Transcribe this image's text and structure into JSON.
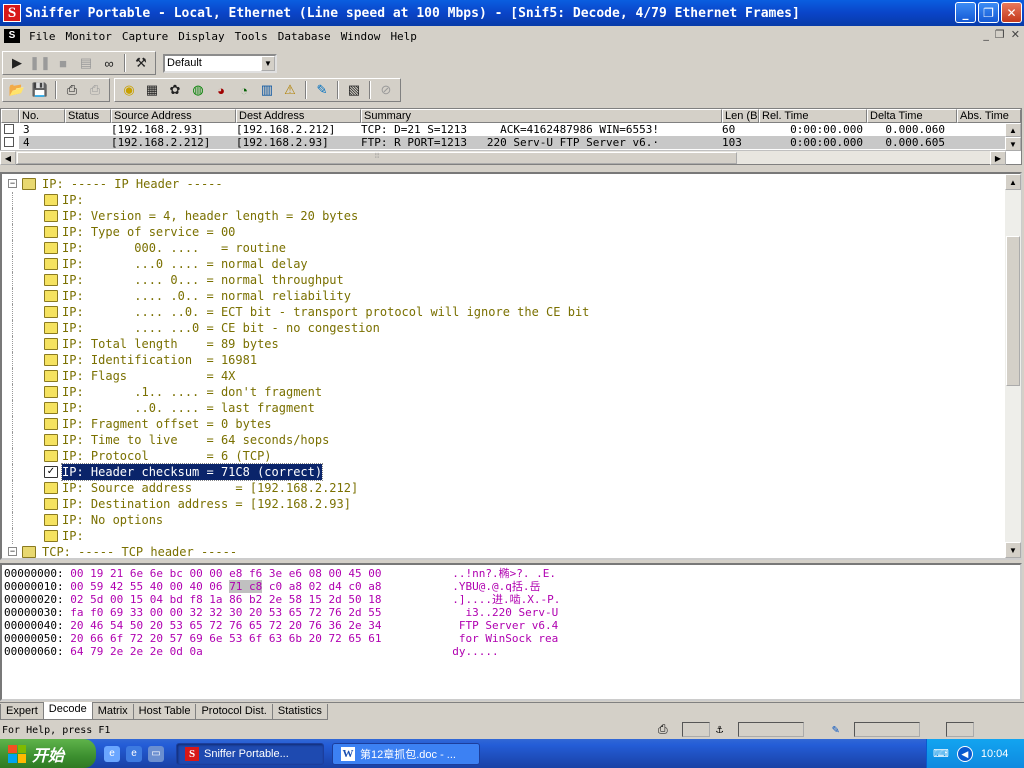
{
  "window": {
    "app_icon": "S",
    "title": "Sniffer Portable - Local, Ethernet (Line speed at 100 Mbps) - [Snif5: Decode, 4/79 Ethernet Frames]",
    "minimize": "_",
    "restore": "❐",
    "close": "✕"
  },
  "menubar": {
    "items": [
      "File",
      "Monitor",
      "Capture",
      "Display",
      "Tools",
      "Database",
      "Window",
      "Help"
    ],
    "mdi_minimize": "_",
    "mdi_restore": "❐",
    "mdi_close": "✕"
  },
  "toolbar": {
    "profile_select": "Default",
    "buttons_row1": [
      "play-icon",
      "pause-icon",
      "stop-icon",
      "stop-display-icon",
      "binoculars-icon",
      "capture-filter-icon"
    ],
    "buttons_row2": [
      "open-folder-icon",
      "save-icon",
      "print-icon",
      "print-preview-icon",
      "dashboard-icon",
      "host-table-icon",
      "matrix-icon",
      "application-response-icon",
      "history-icon",
      "protocol-dist-icon",
      "global-statistics-icon",
      "alarm-log-icon",
      "define-filter-icon",
      "select-filter-icon",
      "stop-capture-icon"
    ]
  },
  "summary": {
    "headers": [
      "No.",
      "Status",
      "Source Address",
      "Dest Address",
      "Summary",
      "Len (B",
      "Rel. Time",
      "Delta Time",
      "Abs. Time"
    ],
    "rows": [
      {
        "no": "3",
        "status": "",
        "src": "[192.168.2.93]",
        "dst": "[192.168.2.212]",
        "summary": "TCP: D=21 S=1213     ACK=4162487986 WIN=6553!",
        "len": "60",
        "rel": "0:00:00.000",
        "delta": "0.000.060",
        "abs": ""
      },
      {
        "no": "4",
        "status": "",
        "src": "[192.168.2.212]",
        "dst": "[192.168.2.93]",
        "summary": "FTP: R PORT=1213   220 Serv-U FTP Server v6.·",
        "len": "103",
        "rel": "0:00:00.000",
        "delta": "0.000.605",
        "abs": ""
      }
    ]
  },
  "decode": {
    "lines": [
      {
        "text": "IP: ----- IP Header -----",
        "level": 0,
        "kind": "root"
      },
      {
        "text": "IP:",
        "level": 1
      },
      {
        "text": "IP: Version = 4, header length = 20 bytes",
        "level": 1
      },
      {
        "text": "IP: Type of service = 00",
        "level": 1
      },
      {
        "text": "IP:       000. ....   = routine",
        "level": 1
      },
      {
        "text": "IP:       ...0 .... = normal delay",
        "level": 1
      },
      {
        "text": "IP:       .... 0... = normal throughput",
        "level": 1
      },
      {
        "text": "IP:       .... .0.. = normal reliability",
        "level": 1
      },
      {
        "text": "IP:       .... ..0. = ECT bit - transport protocol will ignore the CE bit",
        "level": 1
      },
      {
        "text": "IP:       .... ...0 = CE bit - no congestion",
        "level": 1
      },
      {
        "text": "IP: Total length    = 89 bytes",
        "level": 1
      },
      {
        "text": "IP: Identification  = 16981",
        "level": 1
      },
      {
        "text": "IP: Flags           = 4X",
        "level": 1
      },
      {
        "text": "IP:       .1.. .... = don't fragment",
        "level": 1
      },
      {
        "text": "IP:       ..0. .... = last fragment",
        "level": 1
      },
      {
        "text": "IP: Fragment offset = 0 bytes",
        "level": 1
      },
      {
        "text": "IP: Time to live    = 64 seconds/hops",
        "level": 1
      },
      {
        "text": "IP: Protocol        = 6 (TCP)",
        "level": 1
      },
      {
        "text": "IP: Header checksum = 71C8 (correct)",
        "level": 1,
        "selected": true
      },
      {
        "text": "IP: Source address      = [192.168.2.212]",
        "level": 1
      },
      {
        "text": "IP: Destination address = [192.168.2.93]",
        "level": 1
      },
      {
        "text": "IP: No options",
        "level": 1
      },
      {
        "text": "IP:",
        "level": 1
      },
      {
        "text": "TCP: ----- TCP header -----",
        "level": 0,
        "kind": "root"
      }
    ]
  },
  "hex": {
    "rows": [
      {
        "offset": "00000000:",
        "bytes": "00 19 21 6e 6e bc 00 00 e8 f6 3e e6 08 00 45 00",
        "ascii": "..!nn?.椭>?. .E."
      },
      {
        "offset": "00000010:",
        "bytes": "00 59 42 55 40 00 40 06 71 c8 c0 a8 02 d4 c0 a8",
        "ascii": ".YBU@.@.q括.岳",
        "hl_bytes": "71 c8"
      },
      {
        "offset": "00000020:",
        "bytes": "02 5d 00 15 04 bd f8 1a 86 b2 2e 58 15 2d 50 18",
        "ascii": ".]....进.啮.X.-P."
      },
      {
        "offset": "00000030:",
        "bytes": "fa f0 69 33 00 00 32 32 30 20 53 65 72 76 2d 55",
        "ascii": "  i3..220 Serv-U"
      },
      {
        "offset": "00000040:",
        "bytes": "20 46 54 50 20 53 65 72 76 65 72 20 76 36 2e 34",
        "ascii": " FTP Server v6.4"
      },
      {
        "offset": "00000050:",
        "bytes": "20 66 6f 72 20 57 69 6e 53 6f 63 6b 20 72 65 61",
        "ascii": " for WinSock rea"
      },
      {
        "offset": "00000060:",
        "bytes": "64 79 2e 2e 2e 0d 0a",
        "ascii": "dy....."
      }
    ]
  },
  "tabs": [
    "Expert",
    "Decode",
    "Matrix",
    "Host Table",
    "Protocol Dist.",
    "Statistics"
  ],
  "active_tab": "Decode",
  "status": {
    "help": "For Help, press F1"
  },
  "taskbar": {
    "start_label": "开始",
    "tasks": [
      {
        "label": "Sniffer Portable...",
        "active": true,
        "icon": "sniffer-icon"
      },
      {
        "label": "第12章抓包.doc - ...",
        "active": false,
        "icon": "word-icon"
      }
    ],
    "clock": "10:04"
  },
  "colors": {
    "decode_text": "#7a7000",
    "hex_text": "#b000b0",
    "selection": "#0a246a"
  }
}
